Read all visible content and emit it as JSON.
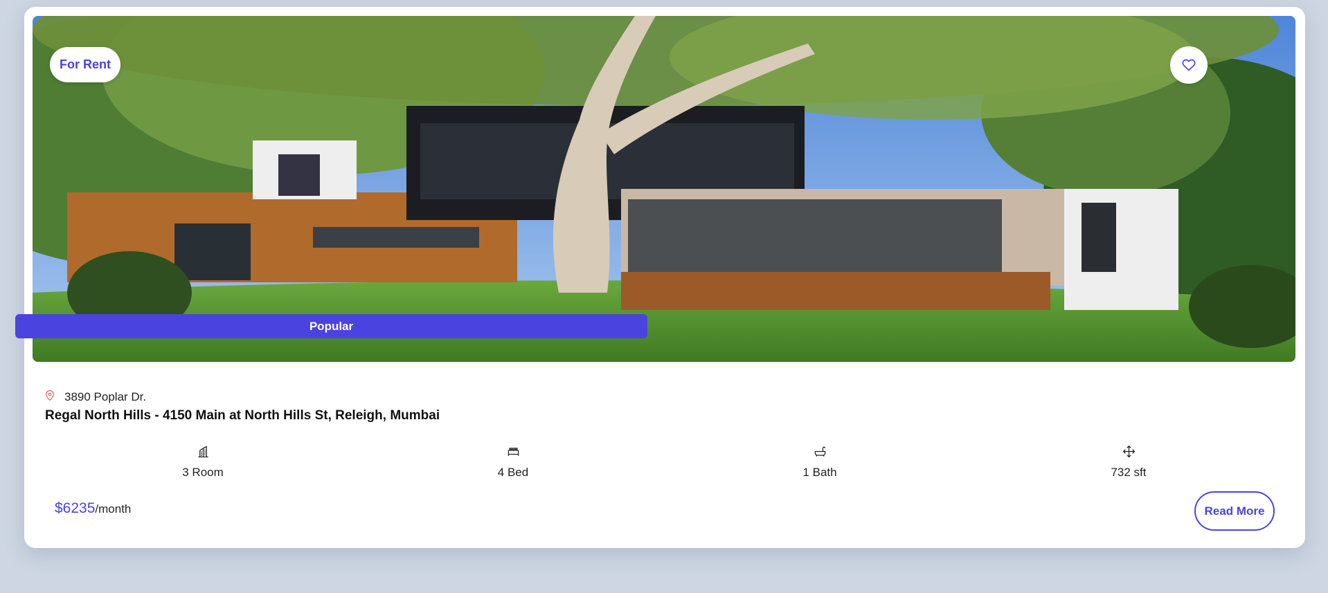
{
  "listing": {
    "status_badge": "For Rent",
    "popular_label": "Popular",
    "address": "3890 Poplar Dr.",
    "title": "Regal North Hills - 4150 Main at North Hills St, Releigh, Mumbai",
    "features": [
      {
        "icon": "building-icon",
        "label": "3 Room"
      },
      {
        "icon": "bed-icon",
        "label": "4 Bed"
      },
      {
        "icon": "bathtub-icon",
        "label": "1 Bath"
      },
      {
        "icon": "move-arrows-icon",
        "label": "732 sft"
      }
    ],
    "price": {
      "amount": "$6235",
      "unit": "/month"
    },
    "read_more_label": "Read More"
  },
  "colors": {
    "accent": "#4b43e0",
    "page_background": "#cdd6e2",
    "card_background": "#ffffff"
  }
}
